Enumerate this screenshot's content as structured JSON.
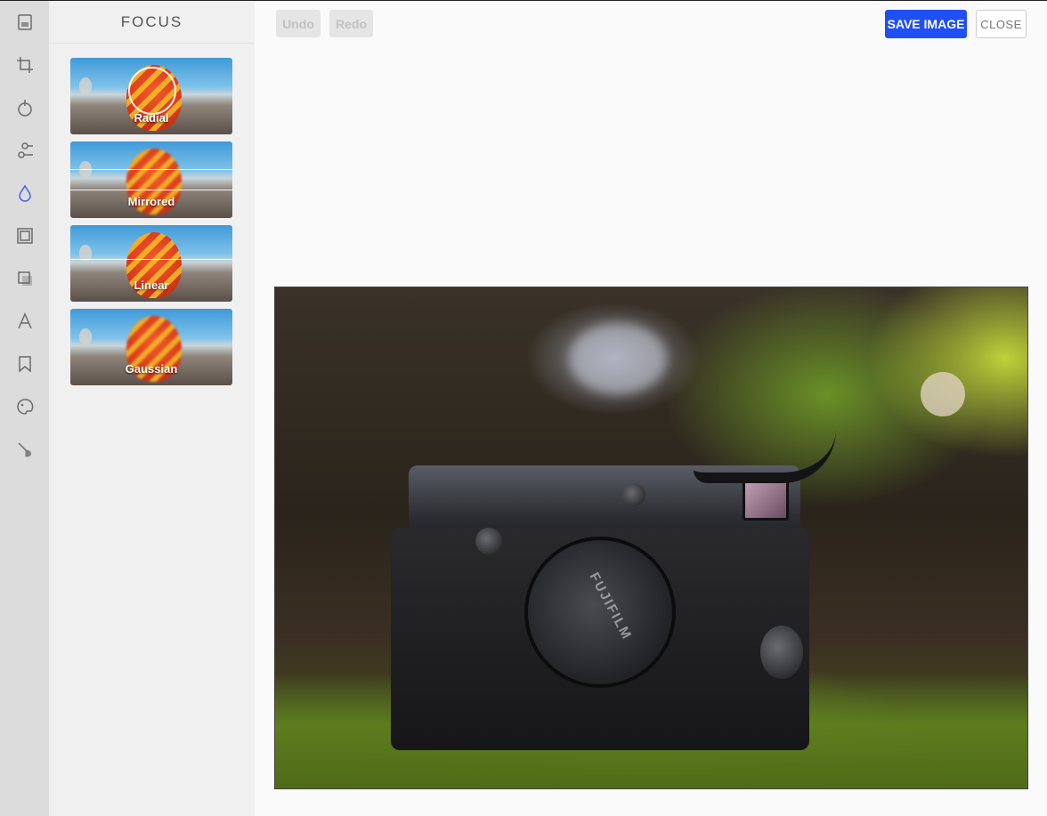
{
  "rail": {
    "items": [
      {
        "name": "image-tool",
        "icon": "image-icon"
      },
      {
        "name": "crop-tool",
        "icon": "crop-icon"
      },
      {
        "name": "filter-tool",
        "icon": "filter-icon"
      },
      {
        "name": "adjust-tool",
        "icon": "sliders-icon"
      },
      {
        "name": "focus-tool",
        "icon": "drop-icon",
        "active": true
      },
      {
        "name": "frame-tool",
        "icon": "frame-icon"
      },
      {
        "name": "overlay-tool",
        "icon": "overlay-icon"
      },
      {
        "name": "text-tool",
        "icon": "text-icon"
      },
      {
        "name": "sticker-tool",
        "icon": "bookmark-icon"
      },
      {
        "name": "draw-tool",
        "icon": "palette-icon"
      },
      {
        "name": "brush-tool",
        "icon": "brush-icon"
      }
    ],
    "accent": "#4a5ee8"
  },
  "panel": {
    "title": "FOCUS",
    "options": [
      {
        "label": "Radial"
      },
      {
        "label": "Mirrored"
      },
      {
        "label": "Linear"
      },
      {
        "label": "Gaussian"
      }
    ]
  },
  "toolbar": {
    "undo_label": "Undo",
    "redo_label": "Redo",
    "save_label": "SAVE IMAGE",
    "close_label": "CLOSE",
    "save_color": "#1f4ff5"
  },
  "photo": {
    "lens_cap_text": "FUJIFILM"
  }
}
